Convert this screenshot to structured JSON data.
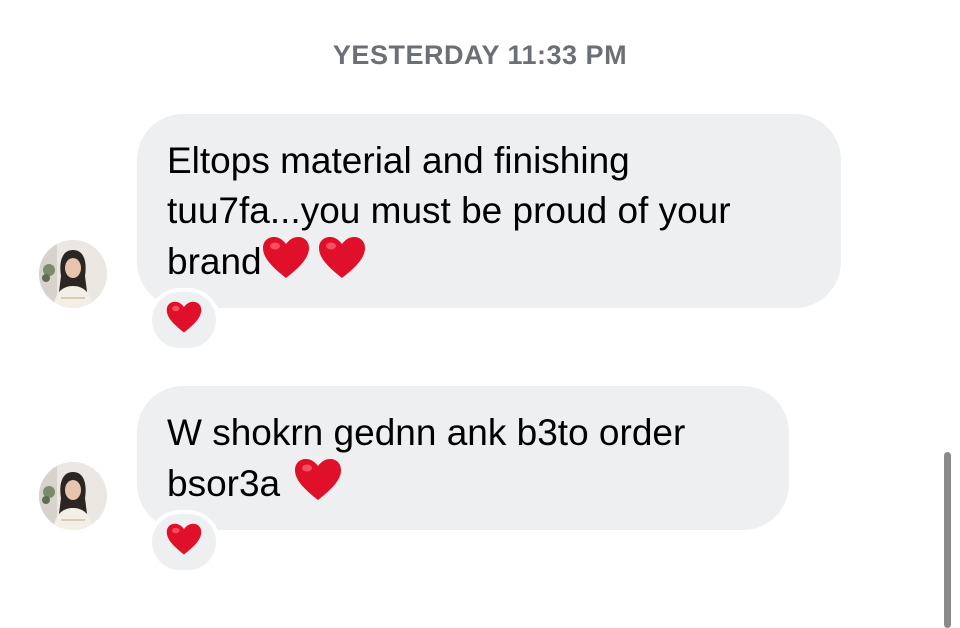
{
  "timestamp": "YESTERDAY 11:33 PM",
  "messages": [
    {
      "lines": [
        "Eltops material and finishing",
        "tuu7fa...you must be proud of your",
        "brand"
      ],
      "trailing_emoji": [
        "heart",
        "heart"
      ],
      "reaction": "heart"
    },
    {
      "lines": [
        "W shokrn gednn ank b3to order",
        "bsor3a"
      ],
      "trailing_emoji": [
        "heart"
      ],
      "reaction": "heart"
    }
  ],
  "colors": {
    "bubble_bg": "#eeeff1",
    "timestamp_text": "#6b6f76",
    "heart": "#e0102a"
  },
  "icons": {
    "reaction": "red-heart-icon",
    "avatar": "user-avatar-photo"
  }
}
